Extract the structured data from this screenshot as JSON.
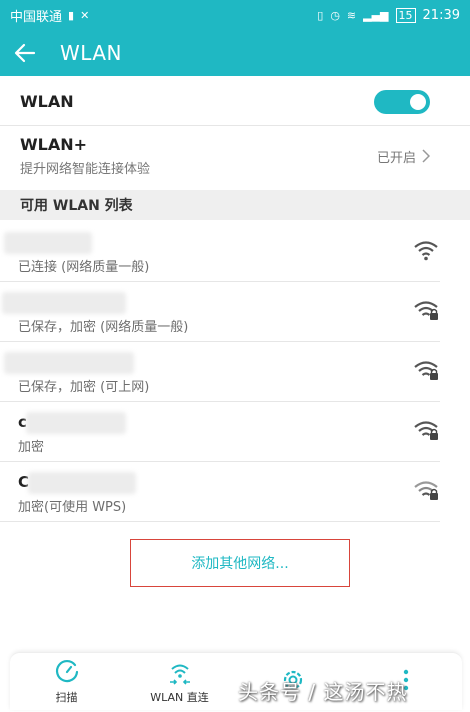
{
  "status_bar": {
    "carrier": "中国联通",
    "network_badge": "15",
    "time": "21:39",
    "icons": [
      "sim-icon",
      "missed-call-icon",
      "vibrate-icon",
      "alarm-icon",
      "wifi-status-icon",
      "signal-icon",
      "battery-icon"
    ]
  },
  "app_bar": {
    "title": "WLAN",
    "back_icon": "arrow-left-icon"
  },
  "wlan_toggle": {
    "label": "WLAN",
    "enabled": true
  },
  "wlan_plus": {
    "title": "WLAN+",
    "subtitle": "提升网络智能连接体验",
    "value": "已开启"
  },
  "section_header": "可用 WLAN 列表",
  "networks": [
    {
      "ssid_visible": "",
      "status": "已连接 (网络质量一般)",
      "secured": false
    },
    {
      "ssid_visible": "",
      "status": "已保存，加密 (网络质量一般)",
      "secured": true
    },
    {
      "ssid_visible": "",
      "status": "已保存，加密 (可上网)",
      "secured": true
    },
    {
      "ssid_visible": "c",
      "status": "加密",
      "secured": true
    },
    {
      "ssid_visible": "C",
      "status": "加密(可使用 WPS)",
      "secured": true
    }
  ],
  "add_network": "添加其他网络...",
  "bottom_tabs": [
    {
      "label": "扫描",
      "icon": "scan-icon"
    },
    {
      "label": "WLAN 直连",
      "icon": "wifi-direct-icon"
    },
    {
      "label": "",
      "icon": "settings-icon"
    },
    {
      "label": "",
      "icon": "more-icon"
    }
  ],
  "watermark": "头条号 / 这汤不热",
  "colors": {
    "accent": "#1fb8c3",
    "highlight_box": "#d8453b",
    "section_bg": "#efefef"
  }
}
